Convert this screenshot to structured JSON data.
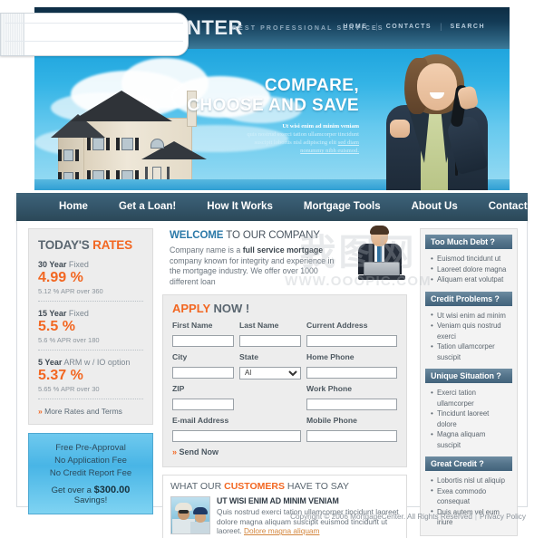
{
  "header": {
    "logo_text": "NTER",
    "logo_tagline": "BEST PROFESSIONAL SERVICES",
    "nav": [
      {
        "label": "HOME"
      },
      {
        "label": "CONTACTS"
      },
      {
        "label": "SEARCH"
      }
    ],
    "separator": "|"
  },
  "hero": {
    "line1": "COMPARE,",
    "line2": "CHOOSE AND SAVE",
    "sub_line1": "Ut wisi enim ad minim veniam",
    "sub_line2": "quis nostrud exerci tation ullamcorper tincidunt",
    "sub_line3": "suscipit lobortis nisl adipiscing elit",
    "sub_line3b": "sed diam",
    "sub_line4": "nonummy nibh euismod."
  },
  "navbar": {
    "items": [
      {
        "label": "Home"
      },
      {
        "label": "Get a Loan!"
      },
      {
        "label": "How It Works"
      },
      {
        "label": "Mortgage Tools"
      },
      {
        "label": "About Us"
      },
      {
        "label": "Contacts"
      }
    ]
  },
  "rates": {
    "title_plain": "TODAY'S ",
    "title_hl": "RATES",
    "items": [
      {
        "term_bold": "30 Year",
        "term_rest": " Fixed",
        "value": "4.99 %",
        "apr": "5.12 % APR over 360"
      },
      {
        "term_bold": "15 Year",
        "term_rest": " Fixed",
        "value": "5.5 %",
        "apr": "5.6 % APR over 180"
      },
      {
        "term_bold": "5 Year",
        "term_rest": " ARM w / IO option",
        "value": "5.37 %",
        "apr": "5.65 % APR over 30"
      }
    ],
    "more_arrow": "»",
    "more_label": "More Rates and Terms"
  },
  "promo": {
    "items": [
      {
        "label": "Free Pre-Approval"
      },
      {
        "label": "No Application Fee"
      },
      {
        "label": "No Credit Report Fee"
      }
    ],
    "savings_pre": "Get over a ",
    "savings_amount": "$300.00",
    "savings_post": " Savings!"
  },
  "welcome": {
    "title_bold": "WELCOME",
    "title_rest": " TO OUR COMPANY",
    "body_pre": "Company name is a ",
    "body_bold": "full service mortgage",
    "body_post": " company known for integrity and experience in the mortgage industry. We offer over 1000 different loan"
  },
  "apply": {
    "title_hl": "APPLY",
    "title_rest": " NOW !",
    "fields": {
      "first_name": {
        "label": "First Name",
        "value": "",
        "placeholder": ""
      },
      "last_name": {
        "label": "Last Name",
        "value": "",
        "placeholder": ""
      },
      "current_address": {
        "label": "Current Address",
        "value": "",
        "placeholder": ""
      },
      "city": {
        "label": "City",
        "value": "",
        "placeholder": ""
      },
      "state": {
        "label": "State",
        "value": "Al"
      },
      "home_phone": {
        "label": "Home Phone",
        "value": "",
        "placeholder": ""
      },
      "zip": {
        "label": "ZIP",
        "value": "",
        "placeholder": ""
      },
      "work_phone": {
        "label": "Work Phone",
        "value": "",
        "placeholder": ""
      },
      "email": {
        "label": "E-mail Address",
        "value": "",
        "placeholder": ""
      },
      "mobile_phone": {
        "label": "Mobile Phone",
        "value": "",
        "placeholder": ""
      }
    },
    "state_options": [
      "Al"
    ],
    "send_arrow": "»",
    "send_label": "Send Now"
  },
  "testimonial": {
    "title_pre": "WHAT OUR ",
    "title_hl": "CUSTOMERS",
    "title_post": " HAVE TO SAY",
    "heading": "UT WISI ENIM AD MINIM VENIAM",
    "body": "Quis nostrud exerci tation ullamcorper tincidunt laoreet dolore magna aliquam suscipit euismod tincidunt ut laoreet. ",
    "link": "Dolore magna aliquam"
  },
  "sidebar": {
    "boxes": [
      {
        "title": "Too Much Debt ?",
        "items": [
          "Euismod tincidunt ut",
          "Laoreet dolore magna",
          "Aliquam erat volutpat"
        ]
      },
      {
        "title": "Credit Problems ?",
        "items": [
          "Ut wisi enim ad minim",
          "Veniam quis nostrud exerci",
          "Tation ullamcorper suscipit"
        ]
      },
      {
        "title": "Unique Situation ?",
        "items": [
          "Exerci tation ullamcorper",
          "Tincidunt laoreet dolore",
          "Magna aliquam suscipit"
        ]
      },
      {
        "title": "Great Credit ?",
        "items": [
          "Lobortis nisl ut aliquip",
          "Exea commodo consequat",
          "Duis autem vel eum iriure"
        ]
      }
    ]
  },
  "footer": {
    "copyright": "Copyright © 2006 MortgageCenter. All Rights Reserved",
    "separator": "|",
    "privacy": "Privacy Policy"
  },
  "watermark": {
    "cjk": "我图网",
    "url": "WWW.OOOPIC.COM"
  },
  "colors": {
    "accent_orange": "#f26722",
    "brand_blue": "#2b79a8",
    "nav_bar": "#35576c",
    "header_dark": "#133a55",
    "sky": "#34b4e6"
  }
}
